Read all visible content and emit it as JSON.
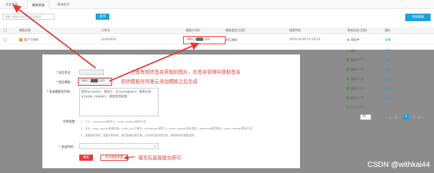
{
  "tabs": [
    {
      "label": "签名管理"
    },
    {
      "label": "模板管理"
    },
    {
      "label": "群发助手"
    }
  ],
  "toolbar": {
    "search_placeholder": "请输入模板名称/短信内容查找",
    "search_button": "查询",
    "add_button": "添加模板"
  },
  "table": {
    "headers": [
      "模板名称",
      "工单号",
      "模板CODE",
      "模板类型(全部)",
      "创建时间",
      "审核状态(全部)",
      "操作"
    ],
    "rows": [
      {
        "name": "客户下单时",
        "order": "12416420",
        "code": "SMS_1███1205",
        "type": "短信通知",
        "time": "2019-10-09 11:20:23",
        "status": "审核中",
        "action": "详情"
      }
    ],
    "partial_rows": [
      {
        "time": "-25 15:50:11",
        "status": "通过",
        "action": "详情"
      },
      {
        "time": "-25 15:50:11",
        "status": "通过",
        "action": "详情"
      },
      {
        "time": "-25 15:50:11",
        "status": "通过",
        "action": "详情"
      },
      {
        "time": "-25 15:50:11",
        "status": "通过",
        "action": "详情"
      },
      {
        "time": "-25 15:50:11",
        "status": "通过",
        "action": "详情"
      },
      {
        "time": "-25 15:50:11",
        "status": "通过",
        "action": "详情"
      }
    ]
  },
  "pagination": {
    "page_size": "10",
    "prev": "< 上一页",
    "current": "1",
    "next": "下一页 >"
  },
  "modal": {
    "sign_label": "* 短信签名",
    "template_label": "* 短信模板",
    "template_value": "SMS_1███1205",
    "content_label": "* 发送模板的内容：",
    "content_text": "您好${name}，收货人：${consignee}，联系方式：${order_mobile}，请您及时处理。",
    "variables_label": "可用变量：",
    "variables_1": "1、个人：consignee(收货人), order_mobile(联系方式)",
    "variables_2": "2、企业：shop_name(店铺名称), order_sn(订单号), consignee(收货人), order_region(所在地区), address(收货地址), order_mobile(联系方式)",
    "variables_3": "3、变量使用说明：变量不能修改，使用变量时请注意，以实际发送内容为准，请按照实际需要选择。",
    "sender_label": "* 发送时机：",
    "submit": "确定",
    "reset": "短信模板重置"
  },
  "annotations": {
    "a1": "上面有短信签名获取的图片，在签名管理中获取签名",
    "a2": "短信模板在阿里云添加模板之后生成",
    "a3": "填写后直接提交即可"
  },
  "watermark": "CSDN @withkai44",
  "colors": {
    "accent": "#1aa3db",
    "annotation": "#e53935",
    "success": "#33aa33"
  }
}
